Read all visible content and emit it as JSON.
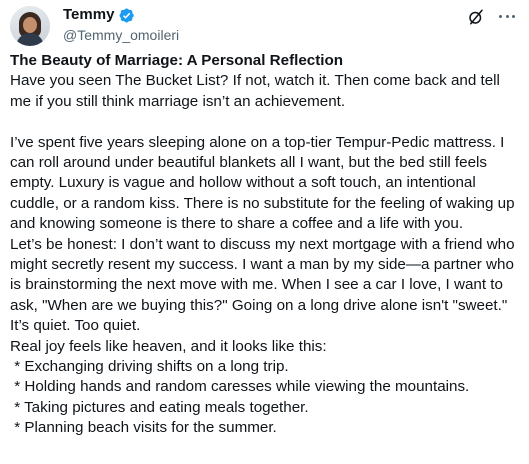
{
  "user": {
    "display_name": "Temmy",
    "handle": "@Temmy_omoileri",
    "verified": true,
    "verified_color": "#1d9bf0",
    "avatar_icon": "profile-photo"
  },
  "actions": {
    "grok_icon": "grok-icon",
    "more_icon": "more-options-icon"
  },
  "post": {
    "title": "The Beauty of Marriage: A Personal Reflection",
    "paragraphs": [
      "Have you seen The Bucket List? If not, watch it. Then come back and tell me if you still think marriage isn’t an achievement.",
      "I’ve spent five years sleeping alone on a top-tier Tempur-Pedic mattress. I can roll around under beautiful blankets all I want, but the bed still feels empty. Luxury is vague and hollow without a soft touch, an intentional cuddle, or a random kiss. There is no substitute for the feeling of waking up and knowing someone is there to share a coffee and a life with you.",
      "Let’s be honest: I don’t want to discuss my next mortgage with a friend who might secretly resent my success. I want a man by my side—a partner who is brainstorming the next move with me. When I see a car I love, I want to ask, \"When are we buying this?\" Going on a long drive alone isn't \"sweet.\" It’s quiet. Too quiet.",
      "Real joy feels like heaven, and it looks like this:"
    ],
    "list_items": [
      " * Exchanging driving shifts on a long trip.",
      " * Holding hands and random caresses while viewing the mountains.",
      " * Taking pictures and eating meals together.",
      " * Planning beach visits for the summer."
    ]
  }
}
